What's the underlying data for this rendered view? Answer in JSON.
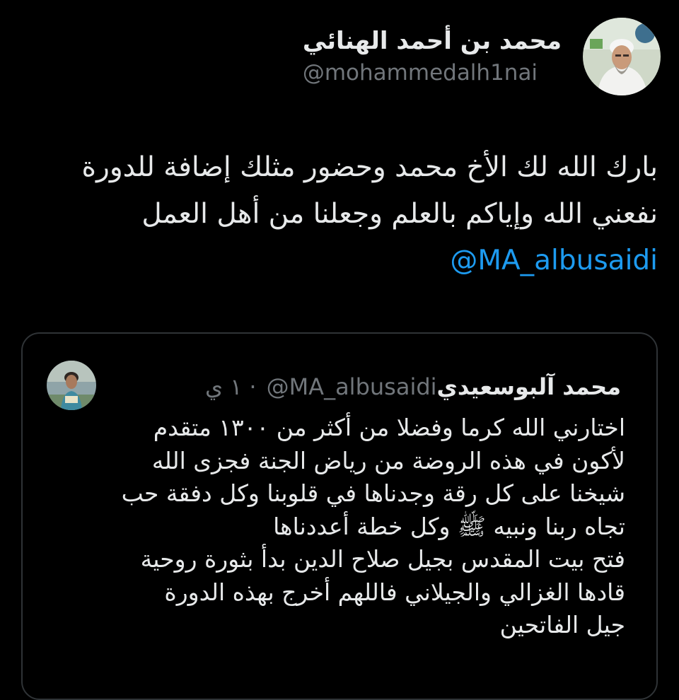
{
  "tweet": {
    "author": {
      "display_name": "محمد بن أحمد الهنائي",
      "handle": "@mohammedalh1nai",
      "avatar_icon": "profile-photo-icon"
    },
    "body": "بارك الله لك الأخ محمد وحضور مثلك إضافة للدورة نفعني الله وإياكم بالعلم وجعلنا من أهل العمل",
    "mention": "@MA_albusaidi"
  },
  "quoted_tweet": {
    "author": {
      "display_name": "محمد آلبوسعيدي",
      "handle": "@MA_albusaidi",
      "avatar_icon": "profile-photo-icon"
    },
    "separator": "·",
    "time": "١ ي",
    "lines": [
      "اختارني الله كرما وفضلا من أكثر من ١٣٠٠ متقدم",
      "لأكون في هذه الروضة من رياض الجنة فجزى الله",
      "شيخنا على كل رقة وجدناها في قلوبنا وكل دفقة حب",
      "تجاه ربنا ونبيه ﷺ وكل خطة أعددناها",
      "فتح بيت المقدس بجيل صلاح الدين بدأ بثورة روحية",
      "قادها الغزالي والجيلاني فاللهم أخرج بهذه الدورة",
      "جيل الفاتحين"
    ]
  },
  "colors": {
    "background": "#000000",
    "text_primary": "#e7e9ea",
    "text_secondary": "#71767b",
    "link": "#1d9bf0",
    "border": "#2f3336"
  }
}
